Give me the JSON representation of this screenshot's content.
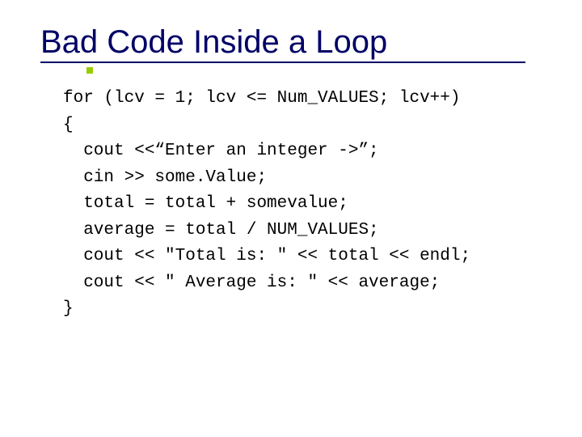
{
  "title": "Bad Code Inside a Loop",
  "code": {
    "l0": "for (lcv = 1; lcv <= Num_VALUES; lcv++)",
    "l1": "{",
    "l2": "  cout <<“Enter an integer ->”;",
    "l3": "  cin >> some.Value;",
    "l4": "  total = total + somevalue;",
    "l5": "  average = total / NUM_VALUES;",
    "l6": "  cout << \"Total is: \" << total << endl;",
    "l7": "  cout << \" Average is: \" << average;",
    "l8": "}"
  }
}
